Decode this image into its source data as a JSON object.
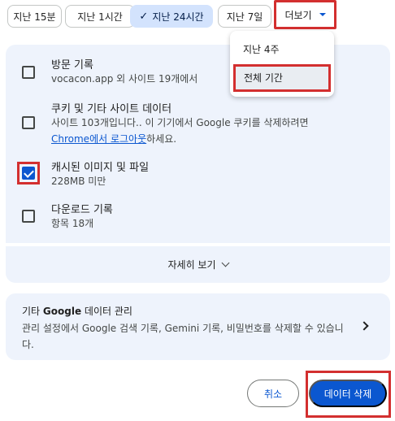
{
  "chips": [
    {
      "label": "지난 15분",
      "selected": false
    },
    {
      "label": "지난 1시간",
      "selected": false
    },
    {
      "label": "지난 24시간",
      "selected": true
    },
    {
      "label": "지난 7일",
      "selected": false
    },
    {
      "label": "더보기",
      "selected": false
    }
  ],
  "items": [
    {
      "title": "방문 기록",
      "sub": "vocacon.app 외 사이트 19개에서",
      "checked": false
    },
    {
      "title": "쿠키 및 기타 사이트 데이터",
      "sub_line1": "사이트 103개입니다.. 이 기기에서 Google 쿠키를 삭제하려면",
      "sub_link": "Chrome에서 로그아웃",
      "sub_after_link": "하세요.",
      "checked": false
    },
    {
      "title": "캐시된 이미지 및 파일",
      "sub": "228MB 미만",
      "checked": true
    },
    {
      "title": "다운로드 기록",
      "sub": "항목 18개",
      "checked": false
    }
  ],
  "details": {
    "label": "자세히 보기"
  },
  "google_card": {
    "title_prefix": "기타 ",
    "title_brand": "Google",
    "title_suffix": " 데이터 관리",
    "desc": "관리 설정에서 Google 검색 기록, Gemini 기록, 비밀번호를 삭제할 수 있습니다."
  },
  "dropdown": {
    "options": [
      "지난 4주",
      "전체 기간"
    ],
    "selected_index": 1
  },
  "actions": {
    "cancel": "취소",
    "delete": "데이터 삭제"
  },
  "colors": {
    "accent": "#0b57d0",
    "panel": "#eef3fc",
    "chip_selected": "#d3e3fd",
    "highlight": "#d32f2f"
  }
}
